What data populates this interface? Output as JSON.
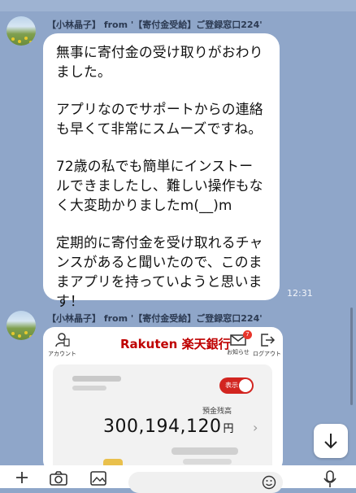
{
  "messages": [
    {
      "sender": "【小林晶子】 from '【寄付金受給】ご登録窓口224'",
      "paragraphs": [
        "無事に寄付金の受け取りがおわり\nました。",
        "アプリなのでサポートからの連絡\nも早くて非常にスムーズですね。",
        "72歳の私でも簡単にインストー\nルできましたし、難しい操作もな\nく大変助かりましたm(__)m",
        "定期的に寄付金を受け取れるチャ\nンスがあると聞いたので、このま\nまアプリを持っていようと思いま\nす！"
      ],
      "time": "12:31"
    },
    {
      "sender": "【小林晶子】 from '【寄付金受給】ご登録窓口224'"
    }
  ],
  "bank_screenshot": {
    "brand_rakuten": "Rakuten",
    "brand_name": "楽天銀行",
    "account_label": "アカウント",
    "notifications_label": "お知らせ",
    "logout_label": "ログアウト",
    "notification_count": "7",
    "toggle_label": "表示",
    "balance_label": "預金残高",
    "balance_amount": "300,194,120",
    "balance_unit": "円"
  },
  "colors": {
    "chat_background": "#8fa6c9",
    "rakuten_red": "#bf0000",
    "toggle_red": "#d22520"
  },
  "icons": [
    "scroll-down-icon",
    "camera-icon",
    "image-icon",
    "emoji-icon",
    "mic-icon",
    "account-icon",
    "mail-icon",
    "logout-icon"
  ]
}
